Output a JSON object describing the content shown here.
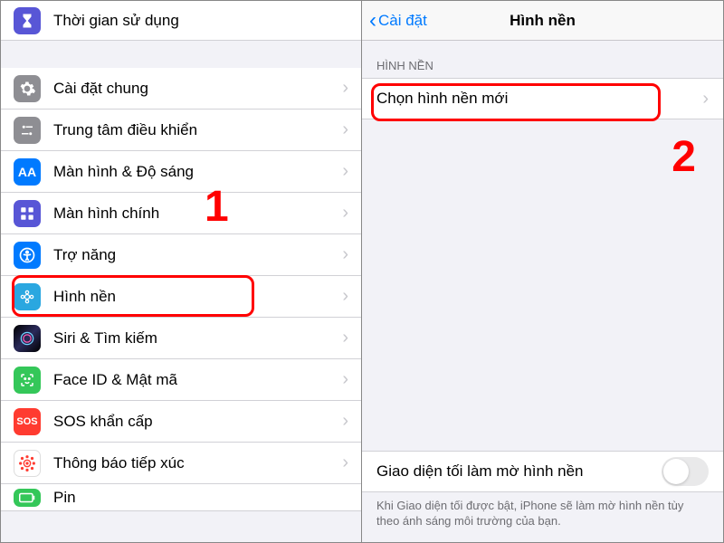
{
  "left": {
    "top_item": "Thời gian sử dụng",
    "items": [
      "Cài đặt chung",
      "Trung tâm điều khiển",
      "Màn hình & Độ sáng",
      "Màn hình chính",
      "Trợ năng",
      "Hình nền",
      "Siri & Tìm kiếm",
      "Face ID & Mật mã",
      "SOS khẩn cấp",
      "Thông báo tiếp xúc",
      "Pin"
    ]
  },
  "right": {
    "back": "Cài đặt",
    "title": "Hình nền",
    "section": "HÌNH NỀN",
    "choose": "Chọn hình nền mới",
    "dark_row": "Giao diện tối làm mờ hình nền",
    "footer": "Khi Giao diện tối được bật, iPhone sẽ làm mờ hình nền tùy theo ánh sáng môi trường của bạn."
  },
  "annotations": {
    "one": "1",
    "two": "2"
  }
}
